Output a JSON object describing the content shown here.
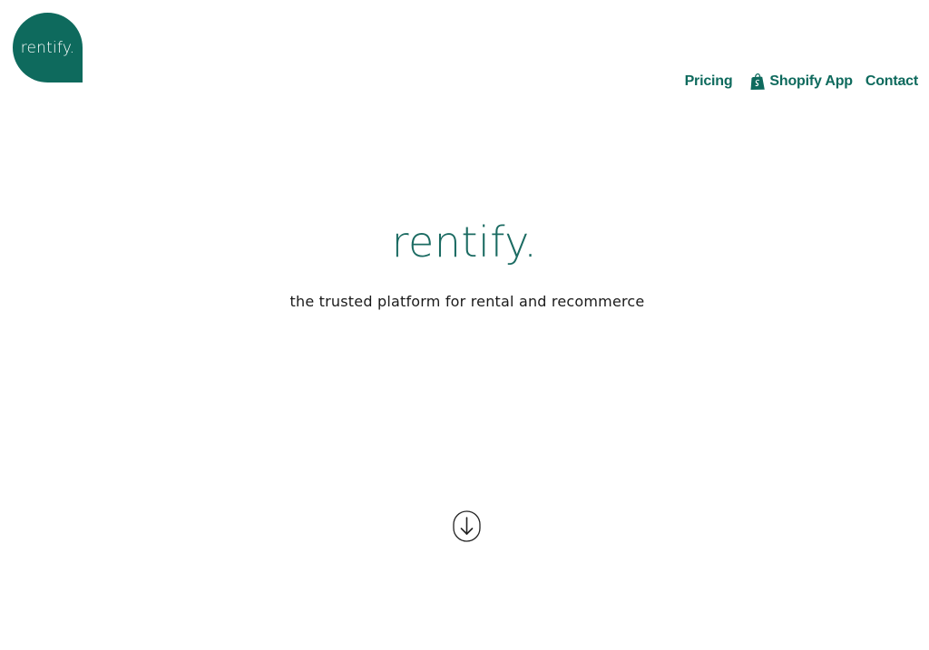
{
  "header": {
    "logo_text": "rentify.",
    "nav": {
      "pricing": "Pricing",
      "shopify_app": "Shopify App",
      "contact": "Contact"
    }
  },
  "hero": {
    "title": "rentify.",
    "subtitle": "the trusted platform for rental and recommerce"
  },
  "icons": {
    "shopify": "shopify-bag-icon",
    "scroll": "arrow-down-circle-icon"
  },
  "colors": {
    "brand": "#0e6a5d",
    "text": "#1a1a1a",
    "background": "#ffffff"
  }
}
